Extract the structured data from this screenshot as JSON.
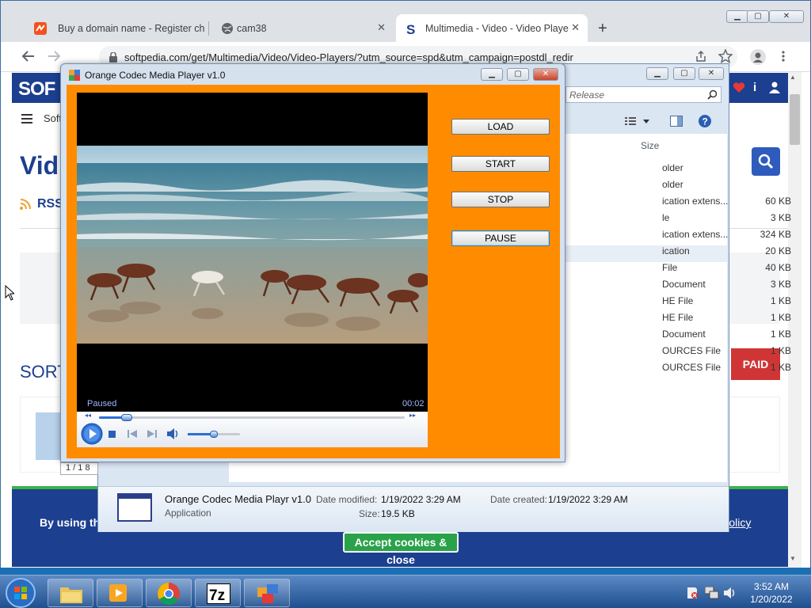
{
  "browser": {
    "tabs": [
      {
        "label": "Buy a domain name - Register ch"
      },
      {
        "label": "cam38"
      },
      {
        "label": "Multimedia - Video - Video Playe"
      }
    ],
    "new_tab": "+",
    "url": "softpedia.com/get/Multimedia/Video/Video-Players/?utm_source=spd&utm_campaign=postdl_redir"
  },
  "page": {
    "logo": "SOF",
    "nav_fragment": "Soft",
    "heading_fragment": "Vid",
    "rss": "RSS",
    "sort_fragment": "SORT",
    "paid_button": "PAID",
    "cookie_text": "By using the s",
    "cookie_link": "Policy",
    "accept_button": "Accept cookies & close"
  },
  "explorer": {
    "search_placeholder": "Release",
    "size_header": "Size",
    "files": [
      {
        "name": "older",
        "size": ""
      },
      {
        "name": "older",
        "size": ""
      },
      {
        "name": "ication extens...",
        "size": "60 KB"
      },
      {
        "name": "le",
        "size": "3 KB"
      },
      {
        "name": "ication extens...",
        "size": "324 KB"
      },
      {
        "name": "ication",
        "size": "20 KB"
      },
      {
        "name": "File",
        "size": "40 KB"
      },
      {
        "name": "Document",
        "size": "3 KB"
      },
      {
        "name": "HE File",
        "size": "1 KB"
      },
      {
        "name": "HE File",
        "size": "1 KB"
      },
      {
        "name": "Document",
        "size": "1 KB"
      },
      {
        "name": "OURCES File",
        "size": "1 KB"
      },
      {
        "name": "OURCES File",
        "size": "1 KB"
      }
    ],
    "details": {
      "name": "Orange Codec Media Playr v1.0",
      "type": "Application",
      "modified_label": "Date modified:",
      "modified_value": "1/19/2022 3:29 AM",
      "size_label": "Size:",
      "size_value": "19.5 KB",
      "created_label": "Date created:",
      "created_value": "1/19/2022 3:29 AM"
    },
    "status_fragment": "1 / 1 8"
  },
  "player": {
    "title": "Orange Codec Media Player v1.0",
    "buttons": {
      "load": "LOAD",
      "start": "START",
      "stop": "STOP",
      "pause": "PAUSE"
    },
    "status": "Paused",
    "time": "00:02",
    "seek_progress": 0.09,
    "volume": 0.5
  },
  "taskbar": {
    "time": "3:52 AM",
    "date": "1/20/2022"
  },
  "colors": {
    "player_orange": "#ff8c00",
    "softpedia_blue": "#1c3f8f",
    "paid_red": "#d03535",
    "accept_green": "#2aa24a"
  }
}
